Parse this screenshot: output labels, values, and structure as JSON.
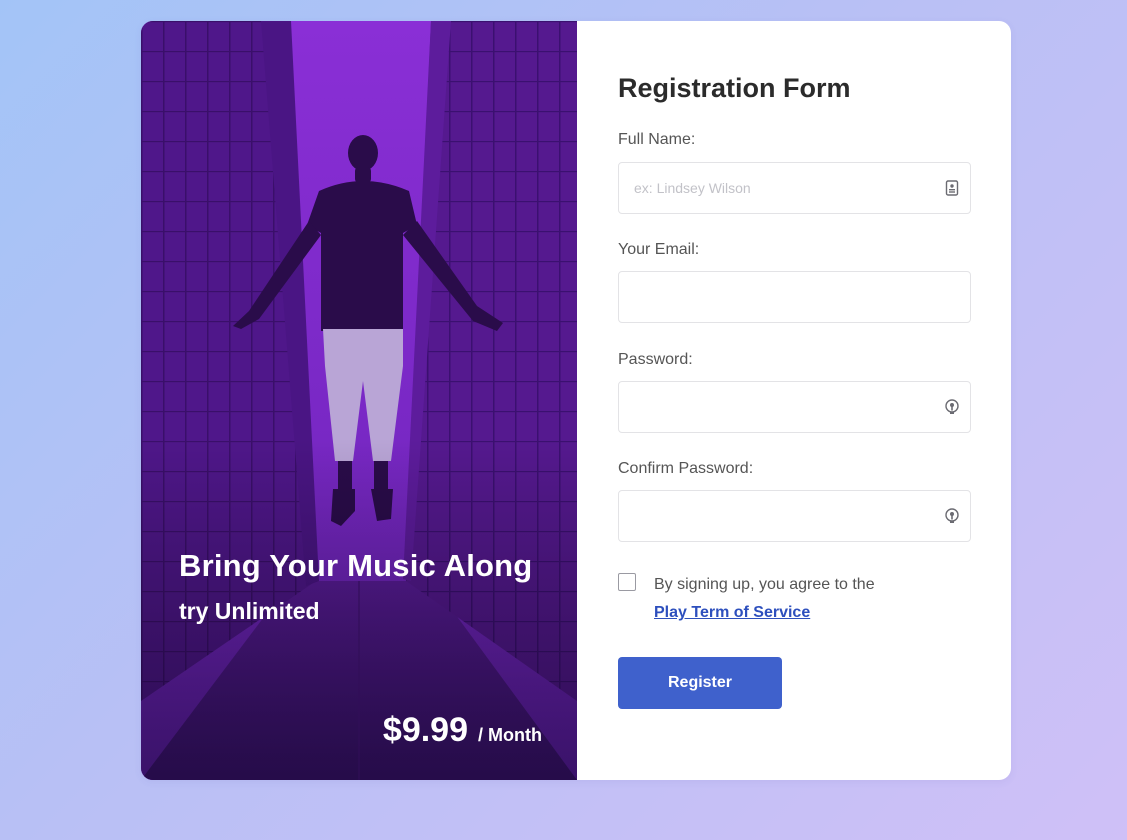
{
  "promo": {
    "headline": "Bring Your Music Along",
    "subline": "try Unlimited",
    "price": "$9.99",
    "period": "/ Month",
    "tint_color": "#5e1aa3"
  },
  "form": {
    "title": "Registration Form",
    "fields": [
      {
        "label": "Full Name:",
        "placeholder": "ex: Lindsey Wilson",
        "value": "",
        "icon": "contact-card-icon"
      },
      {
        "label": "Your Email:",
        "placeholder": "",
        "value": "",
        "icon": ""
      },
      {
        "label": "Password:",
        "placeholder": "",
        "value": "",
        "icon": "password-key-icon"
      },
      {
        "label": "Confirm Password:",
        "placeholder": "",
        "value": "",
        "icon": "password-key-icon"
      }
    ],
    "agreement_text": "By signing up, you agree to the",
    "agreement_link": "Play Term of Service",
    "agreement_checked": false,
    "submit_label": "Register"
  },
  "colors": {
    "accent": "#3f61cc",
    "link": "#2d4fbd",
    "background_start": "#a3c4f7",
    "background_end": "#cfc0f7"
  }
}
